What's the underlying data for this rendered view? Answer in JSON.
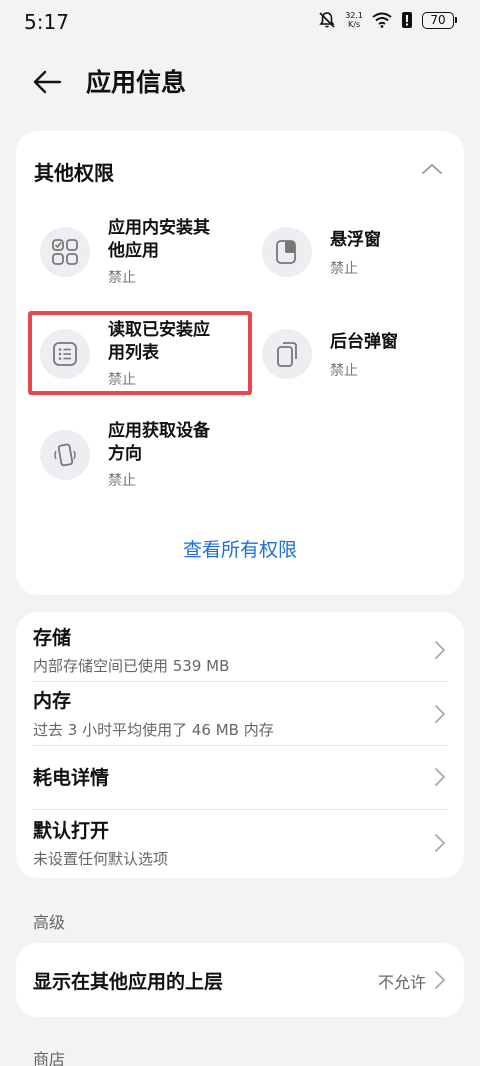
{
  "status_bar": {
    "time": "5:17",
    "net_speed_value": "32.1",
    "net_speed_unit": "K/s",
    "battery": "70"
  },
  "header": {
    "title": "应用信息"
  },
  "permissions": {
    "title": "其他权限",
    "items": [
      {
        "name_line1": "应用内安装其",
        "name_line2": "他应用",
        "status": "禁止",
        "icon": "apps-grid-icon"
      },
      {
        "name_line1": "悬浮窗",
        "name_line2": "",
        "status": "禁止",
        "icon": "floating-window-icon"
      },
      {
        "name_line1": "读取已安装应",
        "name_line2": "用列表",
        "status": "禁止",
        "icon": "list-icon"
      },
      {
        "name_line1": "后台弹窗",
        "name_line2": "",
        "status": "禁止",
        "icon": "background-popup-icon"
      },
      {
        "name_line1": "应用获取设备",
        "name_line2": "方向",
        "status": "禁止",
        "icon": "device-orientation-icon"
      }
    ],
    "view_all": "查看所有权限"
  },
  "info": {
    "storage": {
      "title": "存储",
      "subtitle": "内部存储空间已使用 539 MB"
    },
    "memory": {
      "title": "内存",
      "subtitle": "过去 3 小时平均使用了 46 MB 内存"
    },
    "battery": {
      "title": "耗电详情"
    },
    "default_open": {
      "title": "默认打开",
      "subtitle": "未设置任何默认选项"
    }
  },
  "advanced": {
    "label": "高级",
    "overlay": {
      "title": "显示在其他应用的上层",
      "value": "不允许"
    }
  },
  "store": {
    "label": "商店"
  },
  "colors": {
    "accent": "#1e6fd9",
    "highlight": "#e5484d",
    "background": "#f1f3f5"
  }
}
